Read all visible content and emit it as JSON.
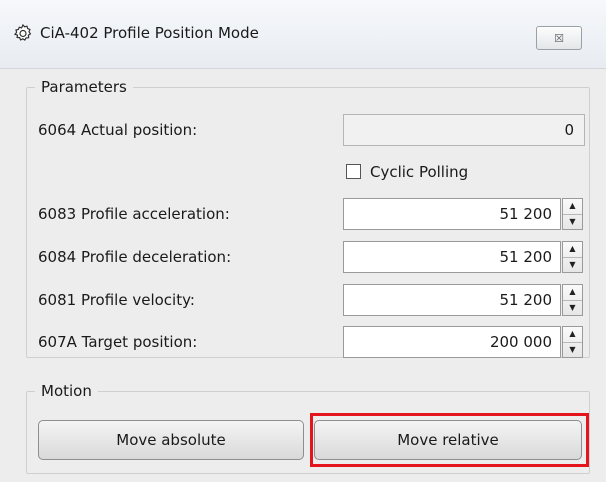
{
  "window": {
    "title": "CiA-402 Profile Position Mode",
    "icon": "gear-icon",
    "close_glyph": "☒"
  },
  "parameters": {
    "group_label": "Parameters",
    "actual_position": {
      "label": "6064  Actual position:",
      "value": "0"
    },
    "cyclic_polling": {
      "label": "Cyclic Polling",
      "checked": false
    },
    "profile_acceleration": {
      "label": "6083  Profile acceleration:",
      "value": "51 200"
    },
    "profile_deceleration": {
      "label": "6084  Profile deceleration:",
      "value": "51 200"
    },
    "profile_velocity": {
      "label": "6081  Profile velocity:",
      "value": "51 200"
    },
    "target_position": {
      "label": "607A  Target position:",
      "value": "200 000"
    }
  },
  "motion": {
    "group_label": "Motion",
    "move_absolute": "Move absolute",
    "move_relative": "Move relative"
  },
  "colors": {
    "highlight": "#e3141c"
  }
}
